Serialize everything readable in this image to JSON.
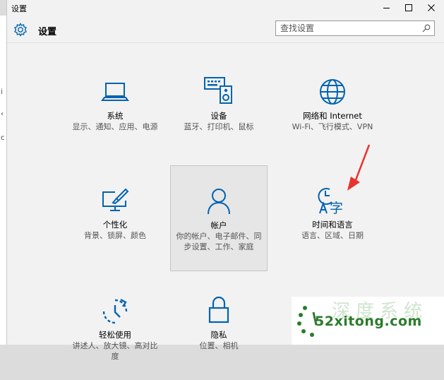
{
  "window": {
    "title": "设置",
    "controls": {
      "minimize": "—",
      "maximize": "☐",
      "close": "✕"
    }
  },
  "header": {
    "title": "设置"
  },
  "search": {
    "placeholder": "查找设置"
  },
  "left_strip": [
    "i",
    "‹",
    "c"
  ],
  "tiles": [
    {
      "name": "系统",
      "desc": "显示、通知、应用、电源",
      "icon": "laptop-icon"
    },
    {
      "name": "设备",
      "desc": "蓝牙、打印机、鼠标",
      "icon": "keyboard-speaker-icon"
    },
    {
      "name": "网络和 Internet",
      "desc": "Wi-Fi、飞行模式、VPN",
      "icon": "globe-icon"
    },
    {
      "name": "个性化",
      "desc": "背景、锁屏、颜色",
      "icon": "paintbrush-monitor-icon"
    },
    {
      "name": "帐户",
      "desc": "你的帐户、电子邮件、同步设置、工作、家庭",
      "icon": "person-icon"
    },
    {
      "name": "时间和语言",
      "desc": "语言、区域、日期",
      "icon": "clock-language-icon"
    },
    {
      "name": "轻松使用",
      "desc": "讲述人、放大镜、高对比度",
      "icon": "ease-of-access-icon"
    },
    {
      "name": "隐私",
      "desc": "位置、相机",
      "icon": "lock-icon"
    }
  ],
  "watermark": {
    "domain": "52xitong.com",
    "brand": "深度系统"
  },
  "colors": {
    "accent": "#0063b1",
    "arrow": "#e8322f"
  }
}
